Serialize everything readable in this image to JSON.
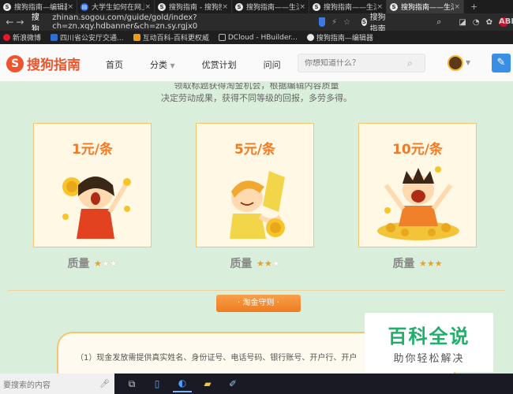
{
  "browser": {
    "tabs": [
      {
        "label": "搜狗指南—编辑器",
        "icon": "S"
      },
      {
        "label": "大学生如何在网上和",
        "icon": "S"
      },
      {
        "label": "搜狗指南 - 搜狗搜索",
        "icon": "S"
      },
      {
        "label": "搜狗指南——生活技",
        "icon": "S"
      },
      {
        "label": "搜狗指南——生活技",
        "icon": "S"
      },
      {
        "label": "搜狗指南——生活技",
        "icon": "S"
      }
    ],
    "nav_back": "←",
    "nav_forward": "→",
    "site_label": "搜狗",
    "url": "zhinan.sogou.com/guide/gold/index?ch=zn.xqy.hdbanner&ch=zn.sy.rgjx0",
    "search_engine_label": "搜狗指南",
    "bookmarks": [
      {
        "label": "新浪微博",
        "color": "#e6162d"
      },
      {
        "label": "四川省公安厅交通...",
        "color": "#2a6fd6"
      },
      {
        "label": "互动百科-百科更权威",
        "color": "#f39c12"
      },
      {
        "label": "DCloud - HBuilder...",
        "color": "#888888"
      },
      {
        "label": "搜狗指南—编辑器",
        "color": "#e8e8e8"
      }
    ]
  },
  "site": {
    "logo_text": "搜狗指南",
    "nav": [
      {
        "label": "首页"
      },
      {
        "label": "分类"
      },
      {
        "label": "优赏计划"
      },
      {
        "label": "问问"
      }
    ],
    "search_placeholder": "你想知道什么？"
  },
  "content": {
    "intro_line1": "领取标题获得淘金机会，根据编辑内容质量",
    "intro_line2": "决定劳动成果，获得不同等级的回报，多劳多得。",
    "cards": [
      {
        "price": "1元/条",
        "quality_label": "质量",
        "stars": 1
      },
      {
        "price": "5元/条",
        "quality_label": "质量",
        "stars": 2
      },
      {
        "price": "10元/条",
        "quality_label": "质量",
        "stars": 3
      }
    ],
    "rules_button": "· 淘金守则 ·",
    "rules_text": "（1）现金发放需提供真实姓名、身份证号、电话号码、银行账号、开户行、开户"
  },
  "watermark": {
    "title": "百科全说",
    "subtitle": "助你轻松解决"
  },
  "taskbar": {
    "search_placeholder": "要搜索的内容"
  }
}
